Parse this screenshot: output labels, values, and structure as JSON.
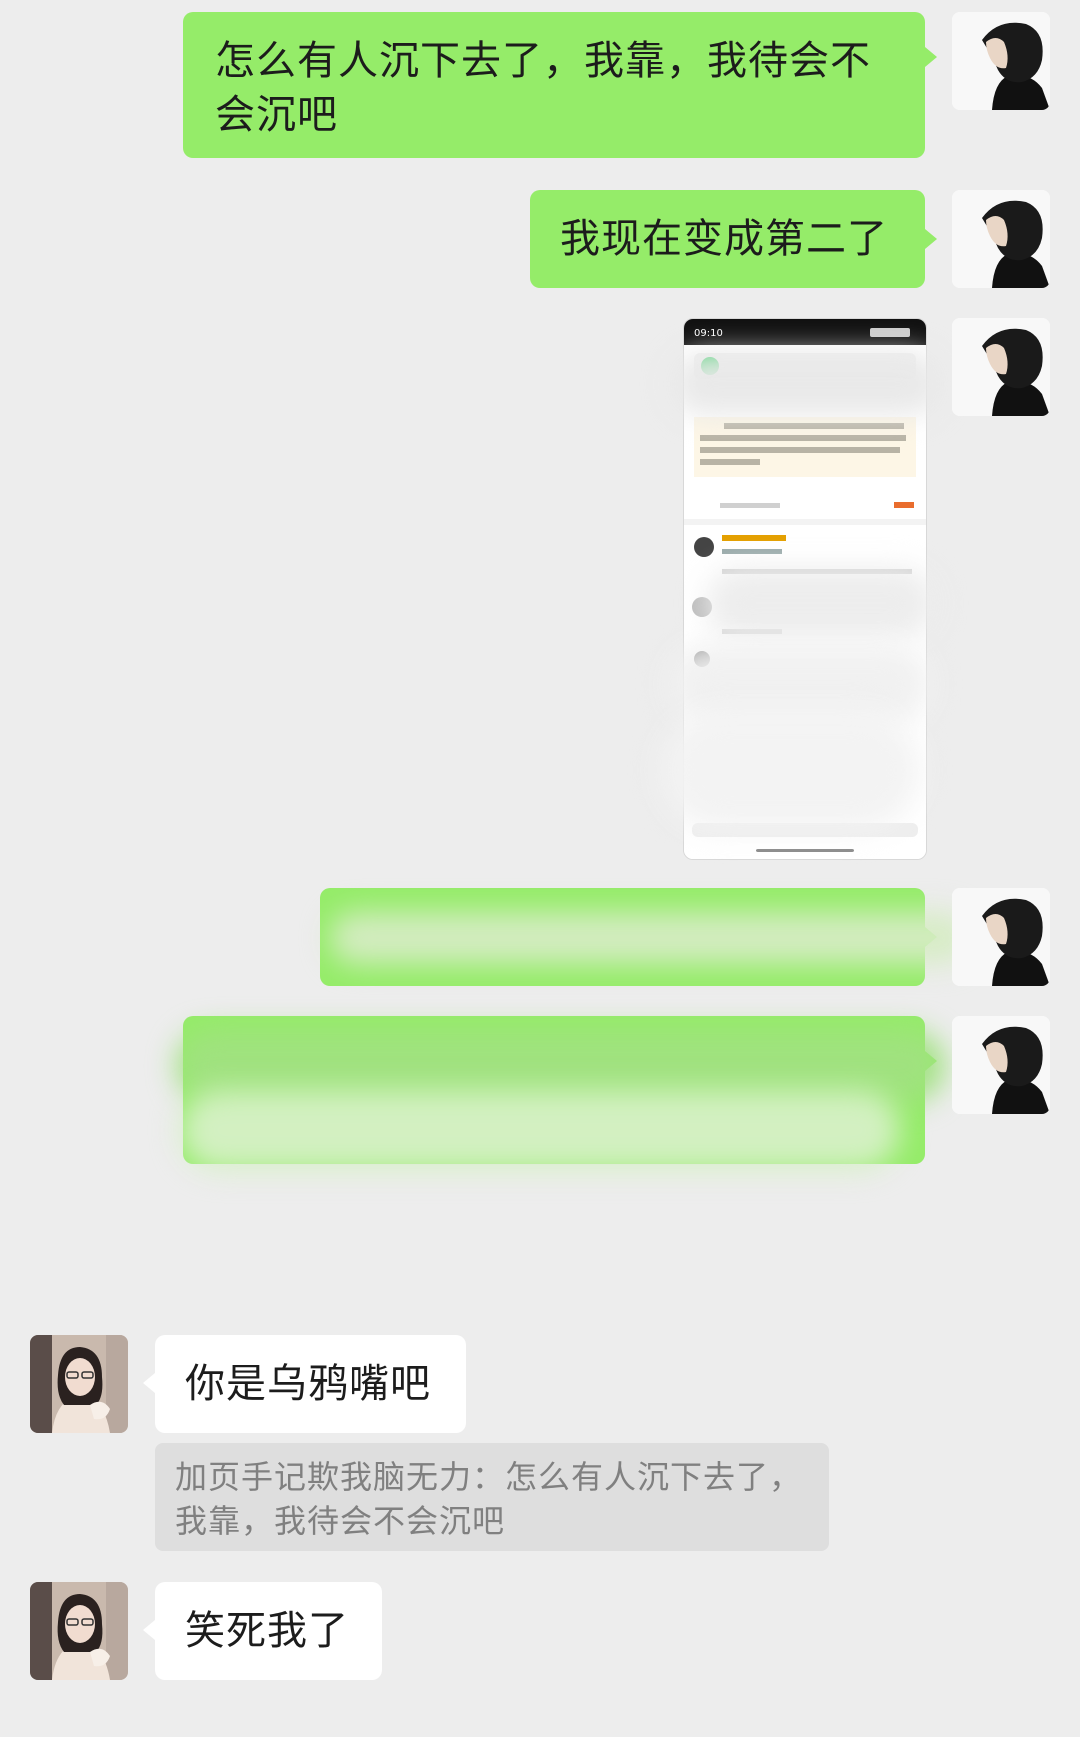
{
  "chat": {
    "messages": [
      {
        "side": "right",
        "type": "text",
        "text": "怎么有人沉下去了，我靠，我待会不\n会沉吧"
      },
      {
        "side": "right",
        "type": "text",
        "text": "我现在变成第二了"
      },
      {
        "side": "right",
        "type": "image",
        "screenshot": {
          "status_time": "09:10"
        }
      },
      {
        "side": "right",
        "type": "text",
        "text": "",
        "redacted": true
      },
      {
        "side": "right",
        "type": "text",
        "text": "",
        "redacted": true
      },
      {
        "side": "left",
        "type": "text",
        "text": "你是乌鸦嘴吧"
      },
      {
        "side": "left",
        "type": "quote",
        "text": "加页手记欺我脑无力：怎么有人沉下去了，我靠，我待会不会沉吧"
      },
      {
        "side": "left",
        "type": "text",
        "text": "笑死我了"
      }
    ]
  },
  "colors": {
    "background": "#ededed",
    "sent_bubble": "#95ec69",
    "received_bubble": "#ffffff",
    "quote_bg": "#dedede",
    "quote_text": "#808080"
  },
  "icons": {
    "avatar_self": "avatar-profile-photo",
    "avatar_other": "avatar-girl-photo"
  }
}
